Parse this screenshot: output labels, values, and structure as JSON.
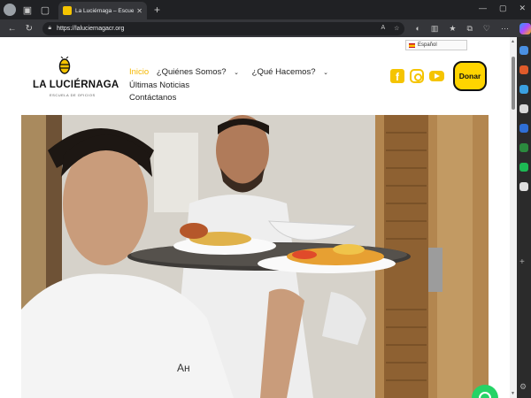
{
  "browser": {
    "tab_title": "La Luciérnaga – Escuela de Oficios",
    "url": "https://laluciernagacr.org",
    "new_tab": "+",
    "close_tab": "✕"
  },
  "site": {
    "logo_name": "LA LUCIÉRNAGA",
    "logo_sub": "ESCUELA DE OFICIOS",
    "language": "Español",
    "menu": {
      "home": "Inicio",
      "about": "¿Quiénes Somos?",
      "what": "¿Qué Hacemos?",
      "news": "Últimas Noticias",
      "contact": "Contáctanos"
    },
    "donate": "Donar",
    "fb_glyph": "f"
  },
  "icons": [
    "back-icon",
    "refresh-icon",
    "lock-icon",
    "facebook-icon",
    "instagram-icon",
    "youtube-icon",
    "whatsapp-icon"
  ],
  "colors": {
    "accent": "#ffd400",
    "menu_active": "#f5b800",
    "whatsapp": "#25d366"
  }
}
